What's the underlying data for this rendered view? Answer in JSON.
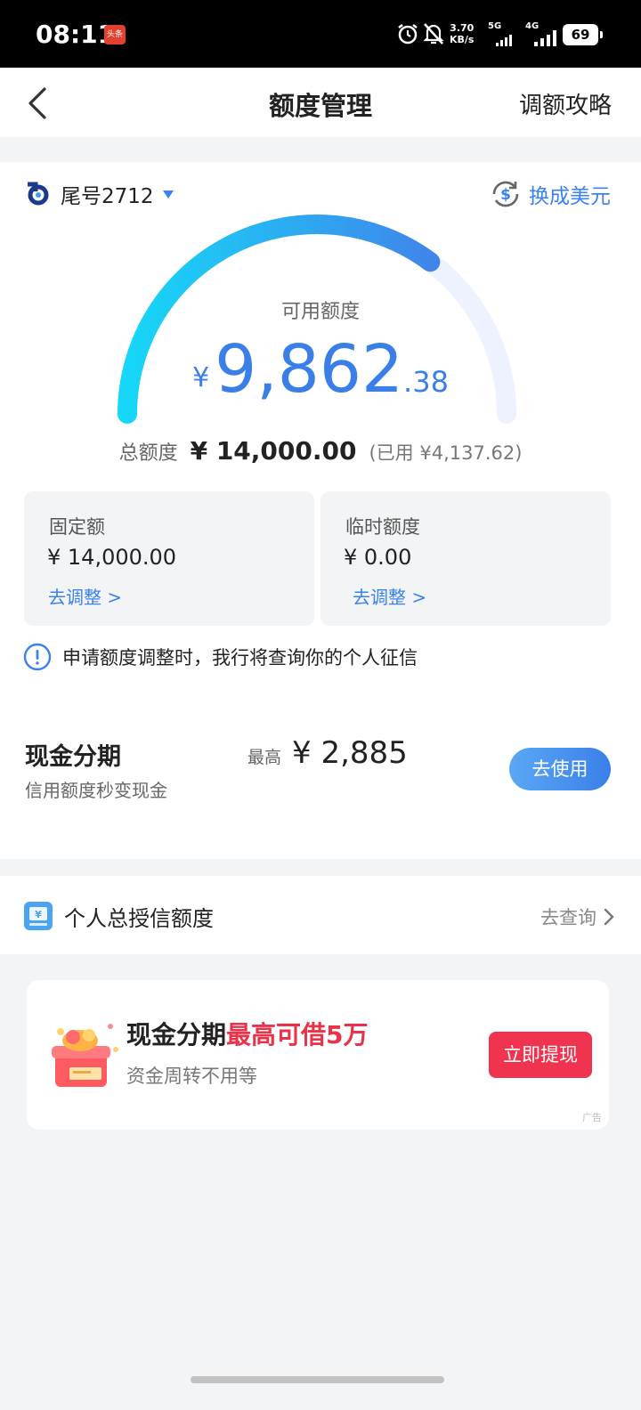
{
  "status_bar": {
    "time": "08:11",
    "app_badge": "头条",
    "net_speed": "3.70",
    "net_speed_unit": "KB/s",
    "net_5g": "5G",
    "net_4g": "4G",
    "battery": "69"
  },
  "header": {
    "title": "额度管理",
    "right_action": "调额攻略"
  },
  "account": {
    "label": "尾号2712",
    "currency_switch": "换成美元"
  },
  "gauge": {
    "label": "可用额度",
    "currency": "¥",
    "amount_int": "9,862",
    "amount_dec": ".38",
    "progress_fraction": 0.704,
    "colors": {
      "start": "#16d7f8",
      "end": "#3f86ea",
      "track": "#eef2fe"
    }
  },
  "total": {
    "label": "总额度",
    "value": "¥ 14,000.00",
    "used": "(已用 ¥4,137.62)"
  },
  "fixed_limit": {
    "title": "固定额",
    "value": "¥ 14,000.00",
    "link": "去调整 >"
  },
  "temp_limit": {
    "title": "临时额度",
    "value": "¥ 0.00",
    "link": "去调整 >"
  },
  "notice": "申请额度调整时，我行将查询你的个人征信",
  "cash_installment": {
    "title": "现金分期",
    "subtitle": "信用额度秒变现金",
    "max_label": "最高",
    "max_value": "¥ 2,885",
    "button": "去使用"
  },
  "personal_credit": {
    "label": "个人总授信额度",
    "link": "去查询"
  },
  "ad": {
    "title_black": "现金分期",
    "title_red": "最高可借5万",
    "subtitle": "资金周转不用等",
    "button": "立即提现",
    "tag": "广告"
  },
  "colors": {
    "accent": "#3a82f0",
    "ad_red": "#f0334e",
    "page_bg": "#f3f4f6"
  }
}
